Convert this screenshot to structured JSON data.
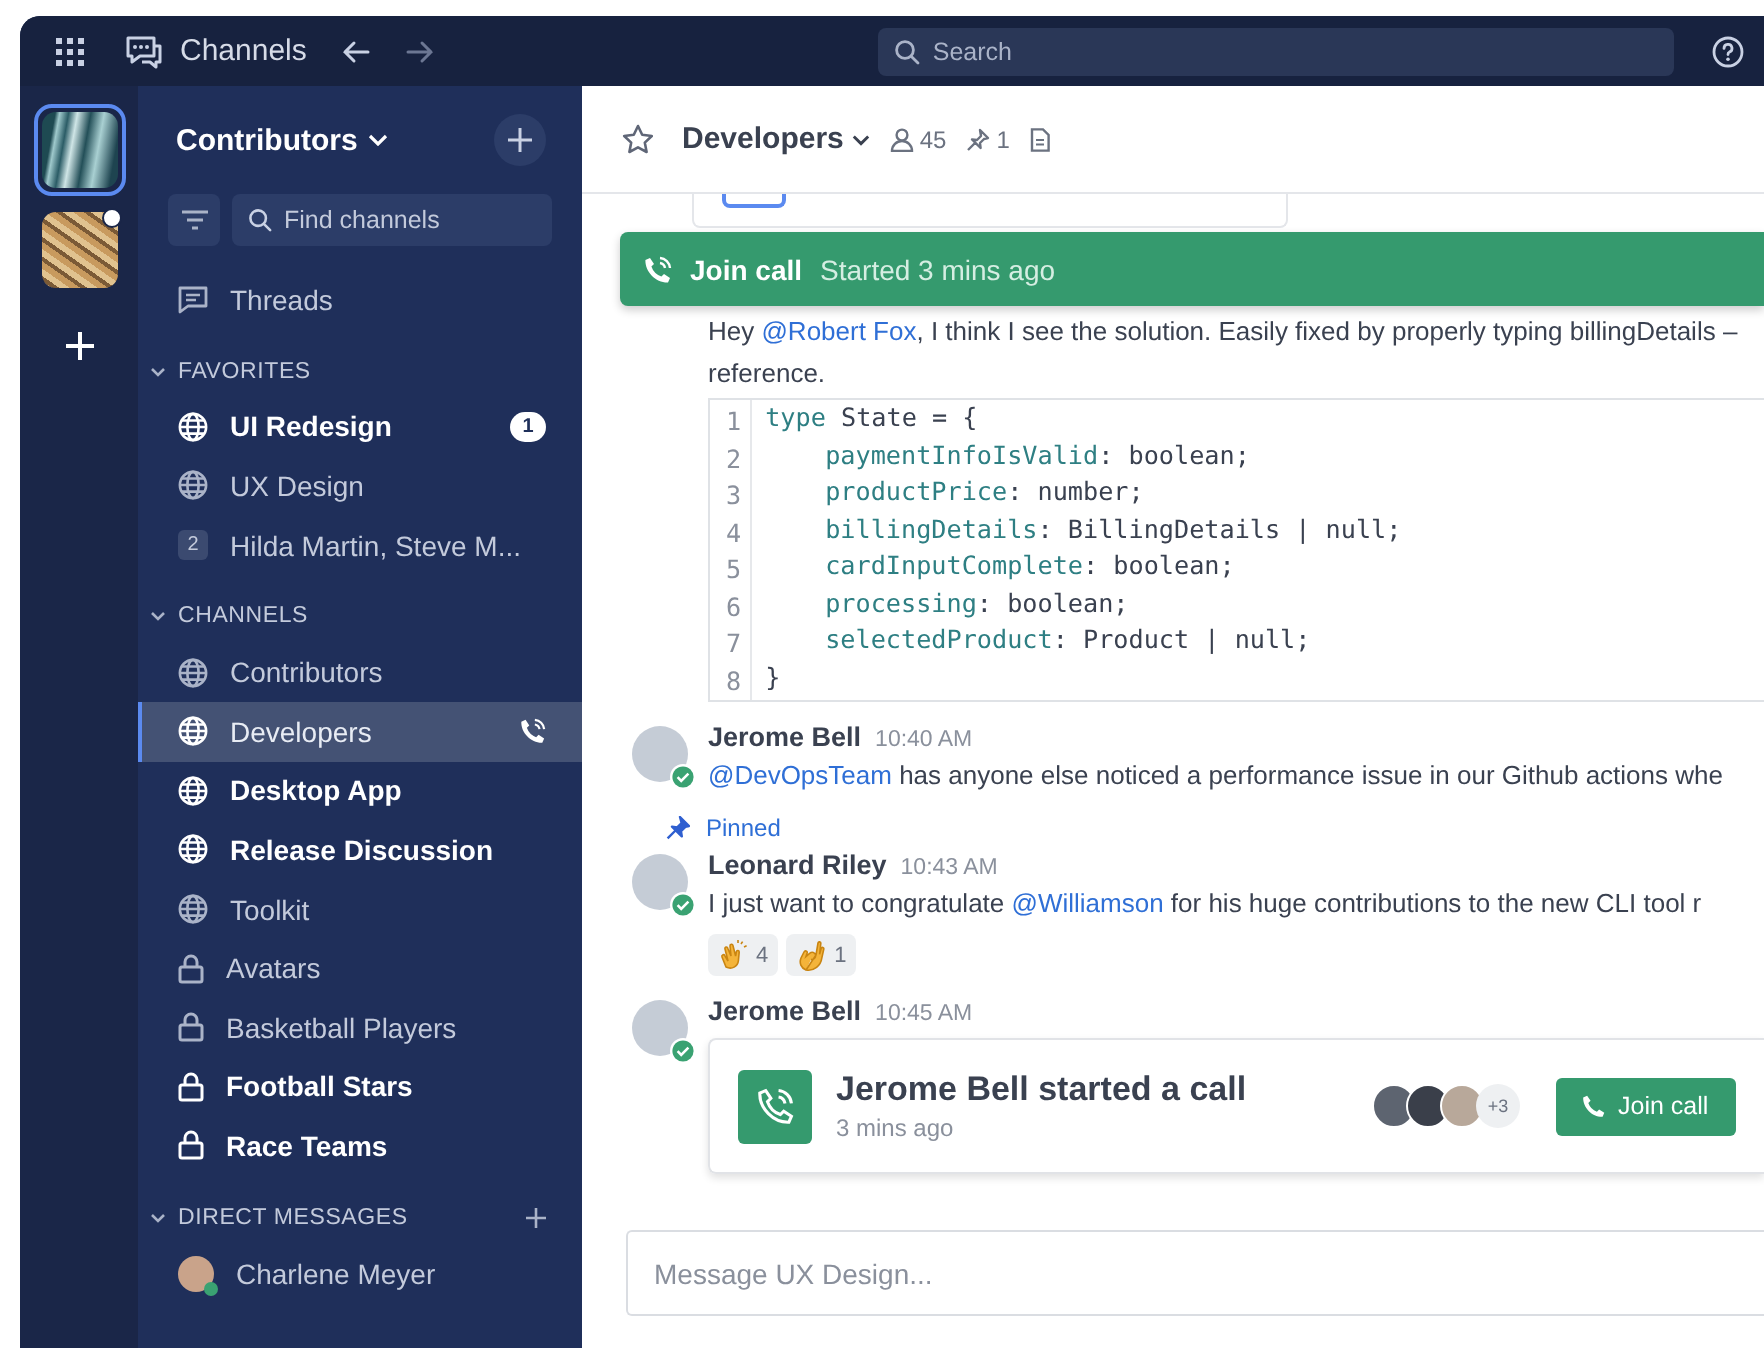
{
  "topbar": {
    "app_title": "Channels",
    "search": {
      "placeholder": "Search"
    }
  },
  "workspaces": [
    {
      "selected": true,
      "notification": false
    },
    {
      "selected": false,
      "notification": true
    }
  ],
  "sidebar": {
    "title": "Contributors",
    "search": {
      "placeholder": "Find channels"
    },
    "threads": "Threads",
    "sections": [
      {
        "title": "FAVORITES",
        "expanded": true,
        "can_add": false,
        "items": [
          {
            "name": "UI Redesign",
            "kind": "globe",
            "unread": true,
            "selected": false,
            "call": false,
            "badge": "1"
          },
          {
            "name": "UX Design",
            "kind": "globe",
            "unread": false,
            "selected": false,
            "call": false
          },
          {
            "name": "Hilda Martin, Steve M...",
            "kind": "group",
            "count": "2",
            "unread": false,
            "selected": false,
            "call": false
          }
        ]
      },
      {
        "title": "CHANNELS",
        "expanded": true,
        "can_add": false,
        "items": [
          {
            "name": "Contributors",
            "kind": "globe",
            "unread": false,
            "selected": false,
            "call": false
          },
          {
            "name": "Developers",
            "kind": "globe",
            "unread": false,
            "selected": true,
            "call": true
          },
          {
            "name": "Desktop App",
            "kind": "globe",
            "unread": true,
            "selected": false,
            "call": false
          },
          {
            "name": "Release Discussion",
            "kind": "globe",
            "unread": true,
            "selected": false,
            "call": false
          },
          {
            "name": "Toolkit",
            "kind": "globe",
            "unread": false,
            "selected": false,
            "call": false
          },
          {
            "name": "Avatars",
            "kind": "lock",
            "unread": false,
            "selected": false,
            "call": false
          },
          {
            "name": "Basketball Players",
            "kind": "lock",
            "unread": false,
            "selected": false,
            "call": false
          },
          {
            "name": "Football Stars",
            "kind": "lock",
            "unread": true,
            "selected": false,
            "call": false
          },
          {
            "name": "Race Teams",
            "kind": "lock",
            "unread": true,
            "selected": false,
            "call": false
          }
        ]
      },
      {
        "title": "DIRECT MESSAGES",
        "expanded": true,
        "can_add": true,
        "items": [
          {
            "name": "Charlene Meyer",
            "kind": "person",
            "online": true,
            "unread": false,
            "selected": false,
            "call": false
          }
        ]
      }
    ]
  },
  "channel": {
    "name": "Developers",
    "members": "45",
    "pins": "1"
  },
  "call_banner": {
    "action": "Join call",
    "status": "Started 3 mins ago"
  },
  "messages": [
    {
      "segments": [
        {
          "kind": "text",
          "text": "Hey "
        },
        {
          "kind": "mention",
          "text": "@Robert Fox"
        },
        {
          "kind": "text",
          "text": ", I think I see the solution. Easily fixed by properly typing billingDetails –"
        }
      ],
      "continuation": "reference.",
      "code": [
        {
          "n": "1",
          "indent": false,
          "tokens": [
            {
              "hl": true,
              "t": "type"
            },
            {
              "hl": false,
              "t": " State = {"
            }
          ]
        },
        {
          "n": "2",
          "indent": true,
          "tokens": [
            {
              "hl": true,
              "t": "paymentInfoIsValid"
            },
            {
              "hl": false,
              "t": ": boolean;"
            }
          ]
        },
        {
          "n": "3",
          "indent": true,
          "tokens": [
            {
              "hl": true,
              "t": "productPrice"
            },
            {
              "hl": false,
              "t": ": number;"
            }
          ]
        },
        {
          "n": "4",
          "indent": true,
          "tokens": [
            {
              "hl": true,
              "t": "billingDetails"
            },
            {
              "hl": false,
              "t": ": BillingDetails | null;"
            }
          ]
        },
        {
          "n": "5",
          "indent": true,
          "tokens": [
            {
              "hl": true,
              "t": "cardInputComplete"
            },
            {
              "hl": false,
              "t": ": boolean;"
            }
          ]
        },
        {
          "n": "6",
          "indent": true,
          "tokens": [
            {
              "hl": true,
              "t": "processing"
            },
            {
              "hl": false,
              "t": ": boolean;"
            }
          ]
        },
        {
          "n": "7",
          "indent": true,
          "tokens": [
            {
              "hl": true,
              "t": "selectedProduct"
            },
            {
              "hl": false,
              "t": ": Product | null;"
            }
          ]
        },
        {
          "n": "8",
          "indent": false,
          "tokens": [
            {
              "hl": false,
              "t": "}"
            }
          ]
        }
      ]
    },
    {
      "author": "Jerome Bell",
      "time": "10:40 AM",
      "online": true,
      "segments": [
        {
          "kind": "mention",
          "text": "@DevOpsTeam"
        },
        {
          "kind": "text",
          "text": " has anyone else noticed a performance issue in our Github actions whe"
        }
      ]
    },
    {
      "pinned": "Pinned",
      "author": "Leonard Riley",
      "time": "10:43 AM",
      "online": true,
      "segments": [
        {
          "kind": "text",
          "text": "I just want to congratulate "
        },
        {
          "kind": "mention",
          "text": "@Williamson"
        },
        {
          "kind": "text",
          "text": " for his huge contributions to the new CLI tool r"
        }
      ],
      "reactions": [
        {
          "kind": "clap",
          "count": "4"
        },
        {
          "kind": "ok",
          "count": "1"
        }
      ]
    },
    {
      "author": "Jerome Bell",
      "time": "10:45 AM",
      "online": true,
      "call": {
        "title": "Jerome Bell started a call",
        "subtitle": "3 mins ago",
        "more": "+3",
        "button": "Join call"
      }
    }
  ],
  "composer": {
    "placeholder": "Message UX Design..."
  }
}
